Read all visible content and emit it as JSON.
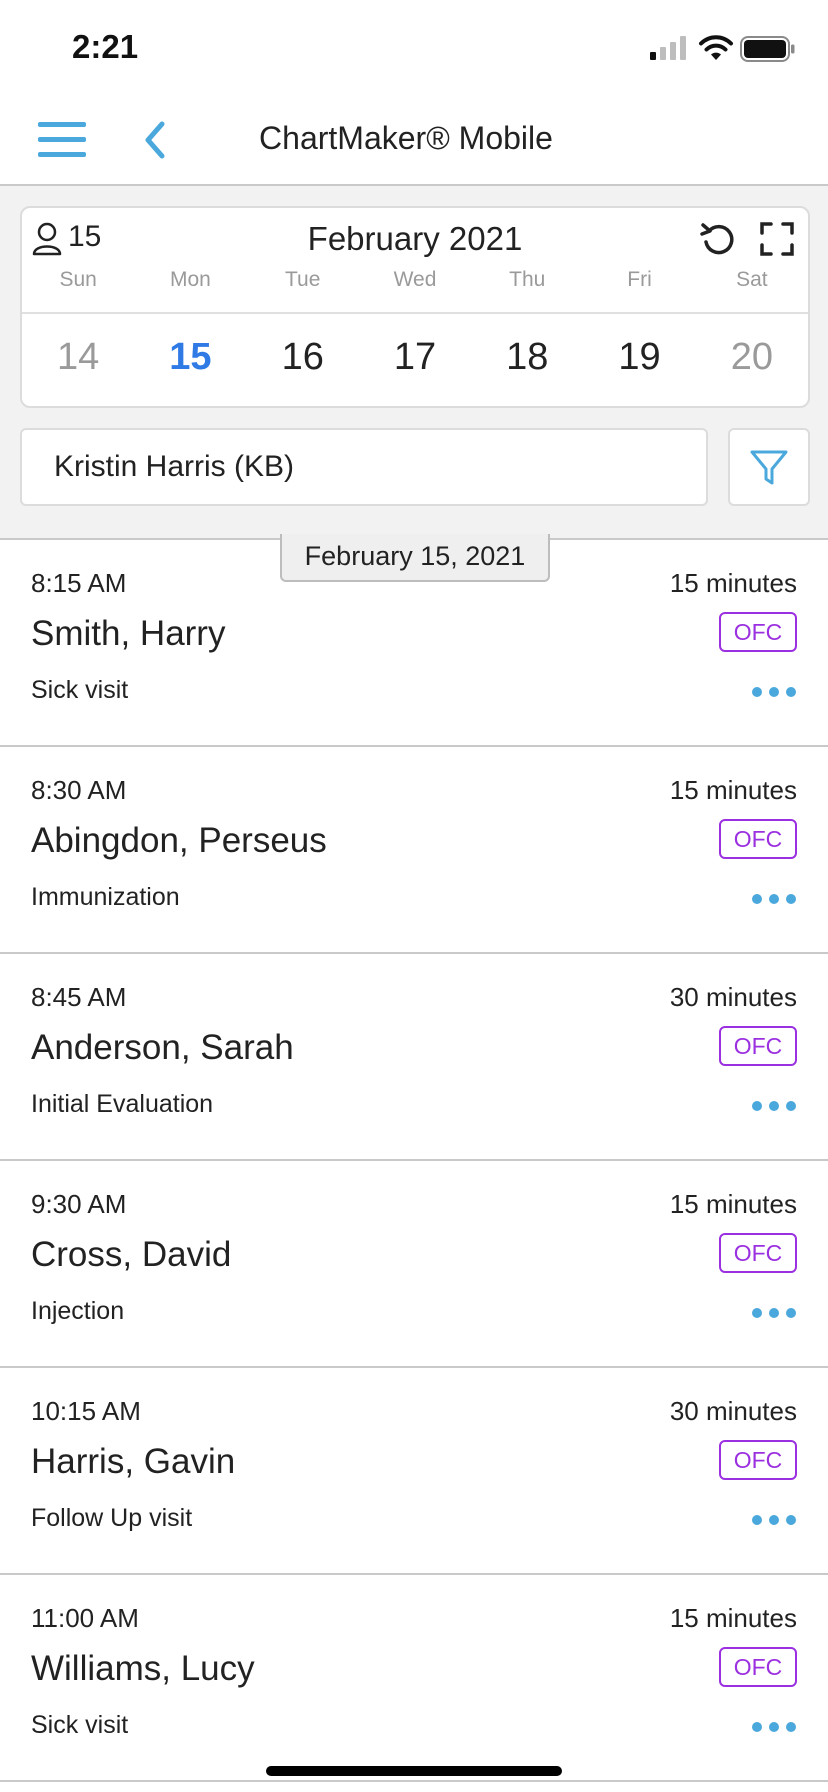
{
  "status_bar": {
    "time": "2:21",
    "signal_icon": "cellular-signal-icon",
    "wifi_icon": "wifi-icon",
    "battery_icon": "battery-icon"
  },
  "nav": {
    "title": "ChartMaker® Mobile",
    "menu_icon": "hamburger-menu-icon",
    "back_icon": "chevron-left-icon"
  },
  "calendar": {
    "patient_count": "15",
    "month": "February 2021",
    "weekdays": [
      "Sun",
      "Mon",
      "Tue",
      "Wed",
      "Thu",
      "Fri",
      "Sat"
    ],
    "days": [
      "14",
      "15",
      "16",
      "17",
      "18",
      "19",
      "20"
    ],
    "selected_day": "15"
  },
  "provider": {
    "value": "Kristin Harris (KB)"
  },
  "list_date": "February 15, 2021",
  "appointments": [
    {
      "time": "8:15 AM",
      "duration": "15 minutes",
      "name": "Smith, Harry",
      "badge": "OFC",
      "reason": "Sick visit"
    },
    {
      "time": "8:30 AM",
      "duration": "15 minutes",
      "name": "Abingdon, Perseus",
      "badge": "OFC",
      "reason": "Immunization"
    },
    {
      "time": "8:45 AM",
      "duration": "30 minutes",
      "name": "Anderson, Sarah",
      "badge": "OFC",
      "reason": "Initial Evaluation"
    },
    {
      "time": "9:30 AM",
      "duration": "15 minutes",
      "name": "Cross, David",
      "badge": "OFC",
      "reason": "Injection"
    },
    {
      "time": "10:15 AM",
      "duration": "30 minutes",
      "name": "Harris, Gavin",
      "badge": "OFC",
      "reason": "Follow Up visit"
    },
    {
      "time": "11:00 AM",
      "duration": "15 minutes",
      "name": "Williams, Lucy",
      "badge": "OFC",
      "reason": "Sick visit"
    }
  ],
  "colors": {
    "accent": "#4aa8dc",
    "selected_day": "#2f7ae5",
    "badge": "#9b30e0",
    "header_bg": "#f2f2f2"
  }
}
